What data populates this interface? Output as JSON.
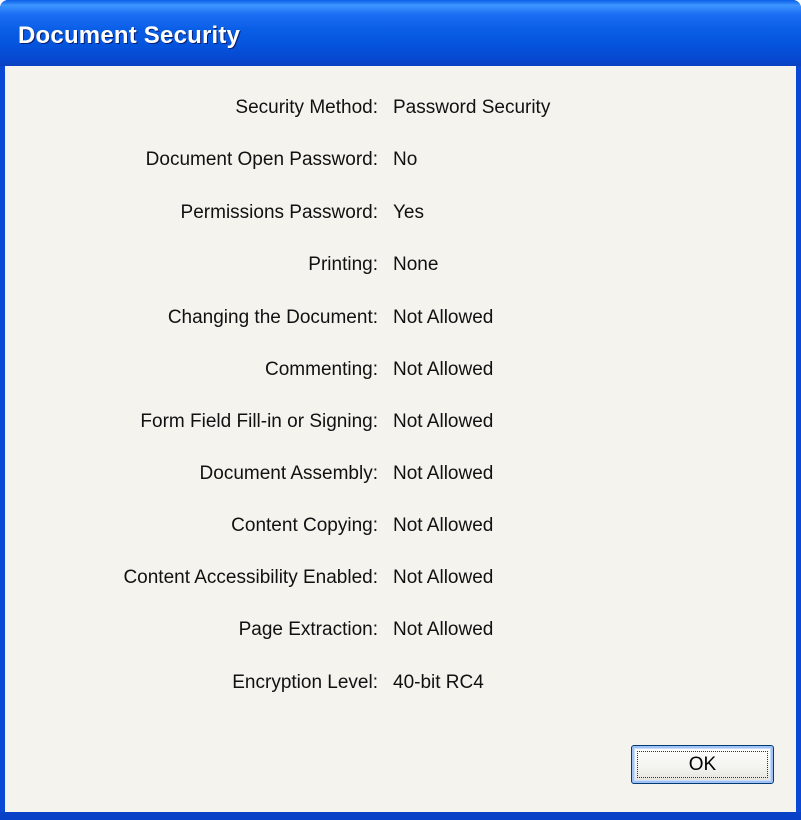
{
  "window": {
    "title": "Document Security"
  },
  "properties": [
    {
      "label": "Security Method:",
      "value": "Password Security"
    },
    {
      "label": "Document Open Password:",
      "value": "No"
    },
    {
      "label": "Permissions Password:",
      "value": "Yes"
    },
    {
      "label": "Printing:",
      "value": "None"
    },
    {
      "label": "Changing the Document:",
      "value": "Not Allowed"
    },
    {
      "label": "Commenting:",
      "value": "Not Allowed"
    },
    {
      "label": "Form Field Fill-in or Signing:",
      "value": "Not Allowed"
    },
    {
      "label": "Document Assembly:",
      "value": "Not Allowed"
    },
    {
      "label": "Content Copying:",
      "value": "Not Allowed"
    },
    {
      "label": "Content Accessibility Enabled:",
      "value": "Not Allowed"
    },
    {
      "label": "Page Extraction:",
      "value": "Not Allowed"
    },
    {
      "label": "Encryption Level:",
      "value": "40-bit RC4"
    }
  ],
  "buttons": {
    "ok_label": "OK"
  },
  "colors": {
    "titlebar_blue": "#0a5ee6",
    "client_background": "#f4f3ee",
    "text": "#111111"
  }
}
